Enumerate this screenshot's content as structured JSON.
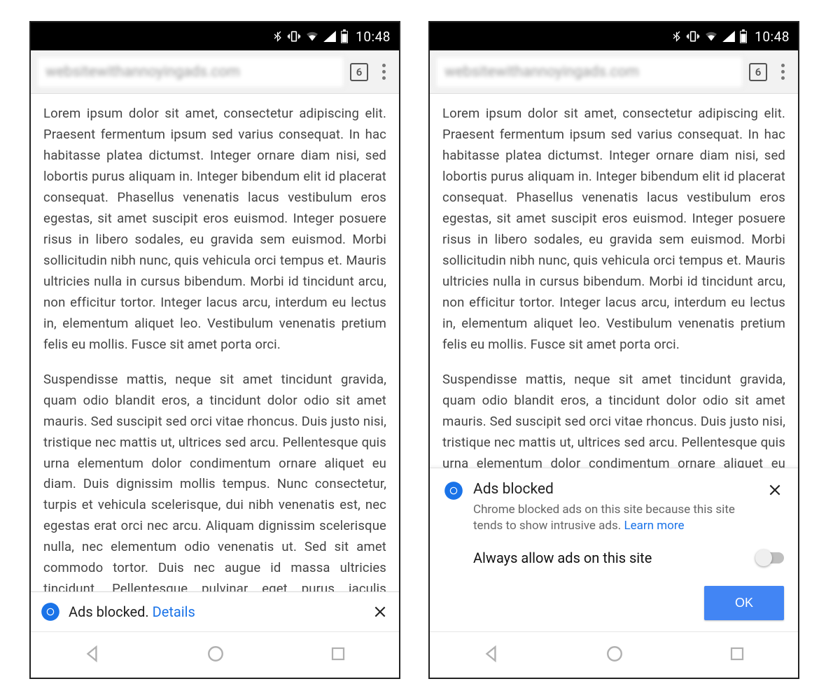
{
  "status": {
    "time": "10:48"
  },
  "toolbar": {
    "url_blurred": "websitewithannoyingads.com",
    "tab_count": "6"
  },
  "body": {
    "para1": "Lorem ipsum dolor sit amet, consectetur adipiscing elit. Praesent fermentum ipsum sed varius consequat. In hac habitasse platea dictumst. Integer ornare diam nisi, sed lobortis purus aliquam in. Integer bibendum elit id placerat consequat. Phasellus venenatis lacus vestibulum eros egestas, sit amet suscipit eros euismod. Integer posuere risus in libero sodales, eu gravida sem euismod. Morbi sollicitudin nibh nunc, quis vehicula orci tempus et. Mauris ultricies nulla in cursus bibendum. Morbi id tincidunt arcu, non efficitur tortor. Integer lacus arcu, interdum eu lectus in, elementum aliquet leo. Vestibulum venenatis pretium felis eu mollis. Fusce sit amet porta orci.",
    "para2": "Suspendisse mattis, neque sit amet tincidunt gravida, quam odio blandit eros, a tincidunt dolor odio sit amet mauris. Sed suscipit sed orci vitae rhoncus. Duis justo nisi, tristique nec mattis ut, ultrices sed arcu. Pellentesque quis urna elementum dolor condimentum ornare aliquet eu diam. Duis dignissim mollis tempus. Nunc consectetur, turpis et vehicula scelerisque, dui nibh venenatis est, nec egestas erat orci nec arcu. Aliquam dignissim scelerisque nulla, nec elementum odio venenatis ut. Sed sit amet commodo tortor. Duis nec augue id massa ultricies tincidunt. Pellentesque pulvinar eget purus iaculis sollicitudin. Maecenas convallis massa eros, quis dignissim dolor posuere vel. Cras ex velit, varius sit amet risus et, varius venenatis velit. Vestibulum egestas orci venenatis",
    "para2_short": "Suspendisse mattis, neque sit amet tincidunt gravida, quam odio blandit eros, a tincidunt dolor odio sit amet mauris. Sed suscipit sed orci vitae rhoncus. Duis justo nisi, tristique nec mattis ut, ultrices sed arcu. Pellentesque quis urna elementum dolor condimentum ornare aliquet eu diam. Duis dignissim mollis tempus. Nunc consectetur,"
  },
  "infobar": {
    "compact_text": "Ads blocked. ",
    "compact_link": "Details"
  },
  "permbar": {
    "title": "Ads blocked",
    "desc": "Chrome blocked ads on this site because this site tends to show intrusive ads. ",
    "learn_more": "Learn more",
    "toggle_label": "Always allow ads on this site",
    "ok": "OK"
  }
}
